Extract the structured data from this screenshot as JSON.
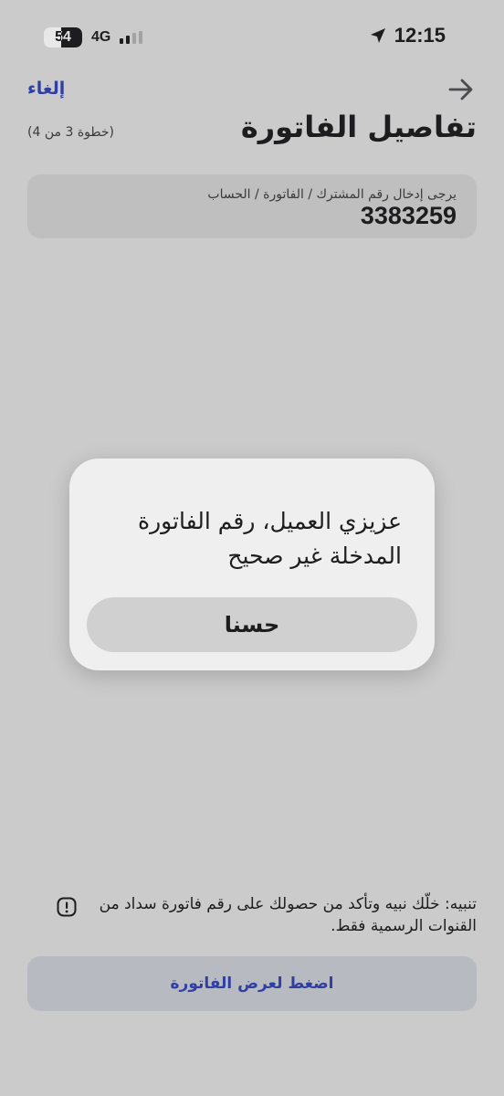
{
  "status_bar": {
    "battery_level": "54",
    "battery_fraction": 0.54,
    "network": "4G",
    "time": "12:15",
    "icons": [
      "battery-icon",
      "signal-icon",
      "location-arrow-icon"
    ]
  },
  "header": {
    "cancel_label": "إلغاء",
    "title": "تفاصيل الفاتورة",
    "step": "(خطوة 3 من 4)",
    "back_icon": "arrow-right-icon"
  },
  "field": {
    "label": "يرجى إدخال رقم المشترك / الفاتورة / الحساب",
    "value": "3383259"
  },
  "warning": {
    "icon": "exclamation-icon",
    "text": "تنبيه: خلّك نبيه وتأكد من حصولك على رقم فاتورة سداد من القنوات الرسمية فقط."
  },
  "view_button_label": "اضغط لعرض الفاتورة",
  "alert": {
    "message": "عزيزي العميل، رقم الفاتورة المدخلة غير صحيح",
    "ok_label": "حسنا"
  },
  "colors": {
    "accent": "#2f3fa3",
    "background": "#cbcbcb",
    "alert_background": "#efefef"
  }
}
